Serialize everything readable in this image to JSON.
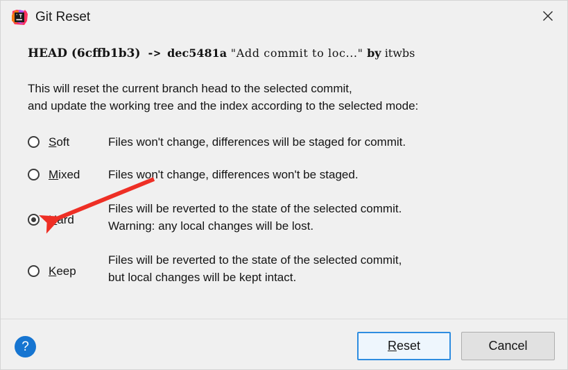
{
  "window": {
    "title": "Git Reset",
    "app_icon": "intellij-idea-icon",
    "close_icon": "close-icon",
    "background_color": "#f0f0f0"
  },
  "commit_line": {
    "head_label": "HEAD (6cffb1b3)",
    "arrow": "->",
    "target_hash": "dec5481a",
    "quote_open": "\"",
    "subject": "Add commit to loc...",
    "quote_close": "\"",
    "by_label": "by",
    "author": "itwbs"
  },
  "description": {
    "line1": "This will reset the current branch head to the selected commit,",
    "line2": "and update the working tree and the index according to the selected mode:"
  },
  "options": [
    {
      "id": "soft",
      "mnemonic": "S",
      "rest": "oft",
      "checked": false,
      "desc_line1": "Files won't change, differences will be staged for commit.",
      "desc_line2": ""
    },
    {
      "id": "mixed",
      "mnemonic": "M",
      "rest": "ixed",
      "checked": false,
      "desc_line1": "Files won't change, differences won't be staged.",
      "desc_line2": ""
    },
    {
      "id": "hard",
      "mnemonic": "H",
      "rest": "ard",
      "checked": true,
      "desc_line1": "Files will be reverted to the state of the selected commit.",
      "desc_line2": "Warning: any local changes will be lost."
    },
    {
      "id": "keep",
      "mnemonic": "K",
      "rest": "eep",
      "checked": false,
      "desc_line1": "Files will be reverted to the state of the selected commit,",
      "desc_line2": "but local changes will be kept intact."
    }
  ],
  "footer": {
    "help_icon": "question-mark-icon",
    "help_label": "?",
    "reset_mnemonic": "R",
    "reset_rest": "eset",
    "cancel_label": "Cancel",
    "default_button_accent": "#2d8ce0"
  },
  "annotation": {
    "arrow_color": "#ee2f25",
    "name": "red-pointer-arrow",
    "points_to": "hard-radio"
  }
}
